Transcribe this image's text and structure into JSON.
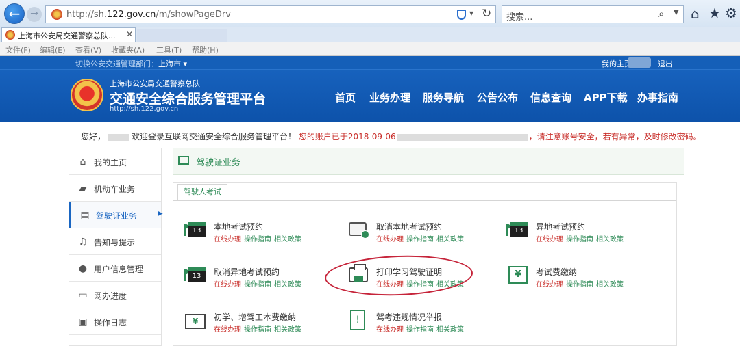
{
  "browser": {
    "url_prefix": "http://sh.",
    "url_domain": "122.gov.cn",
    "url_path": "/m/showPageDrv",
    "search_placeholder": "搜索...",
    "tab_title": "上海市公安局交通警察总队...",
    "menu": [
      "文件(F)",
      "编辑(E)",
      "查看(V)",
      "收藏夹(A)",
      "工具(T)",
      "帮助(H)"
    ],
    "icons": [
      "back-icon",
      "forward-icon",
      "shield-icon",
      "refresh-icon",
      "search-icon",
      "home-icon",
      "star-icon",
      "gear-icon"
    ]
  },
  "site": {
    "switch_label": "切换公安交通管理部门：",
    "switch_value": "上海市 ▾",
    "my_label": "我的主页",
    "logout": "退出",
    "subtitle": "上海市公安局交通警察总队",
    "title": "交通安全综合服务管理平台",
    "url": "http://sh.122.gov.cn",
    "nav": [
      "首页",
      "业务办理",
      "服务导航",
      "公告公布",
      "信息查询",
      "APP下载",
      "办事指南"
    ],
    "colors": {
      "header": "#1a66c2",
      "accent_green": "#2e8b57",
      "alert_red": "#c9302c"
    }
  },
  "welcome": {
    "greeting": "您好，",
    "text": "欢迎登录互联网交通安全综合服务管理平台！",
    "notice_start": "您的账户已于2018-09-06",
    "notice_end": "，请注意账号安全，若有异常，及时修改密码。"
  },
  "sidebar": {
    "items": [
      {
        "label": "我的主页",
        "icon": "home-icon"
      },
      {
        "label": "机动车业务",
        "icon": "truck-icon"
      },
      {
        "label": "驾驶证业务",
        "icon": "license-icon"
      },
      {
        "label": "告知与提示",
        "icon": "bell-icon"
      },
      {
        "label": "用户信息管理",
        "icon": "user-icon"
      },
      {
        "label": "网办进度",
        "icon": "progress-icon"
      },
      {
        "label": "操作日志",
        "icon": "log-icon"
      }
    ]
  },
  "main": {
    "section_title": "驾驶证业务",
    "sub_tab": "驾驶人考试",
    "link_online": "在线办理",
    "link_guide": "操作指南",
    "link_policy": "相关政策",
    "services": [
      {
        "title": "本地考试预约",
        "icon": "calendar-icon"
      },
      {
        "title": "取消本地考试预约",
        "icon": "card-icon"
      },
      {
        "title": "异地考试预约",
        "icon": "calendar-icon"
      },
      {
        "title": "取消异地考试预约",
        "icon": "calendar-icon"
      },
      {
        "title": "打印学习驾驶证明",
        "icon": "printer-icon"
      },
      {
        "title": "考试费缴纳",
        "icon": "fee-icon"
      },
      {
        "title": "初学、增驾工本费缴纳",
        "icon": "fee-icon"
      },
      {
        "title": "驾考违规情况举报",
        "icon": "report-icon"
      }
    ]
  }
}
